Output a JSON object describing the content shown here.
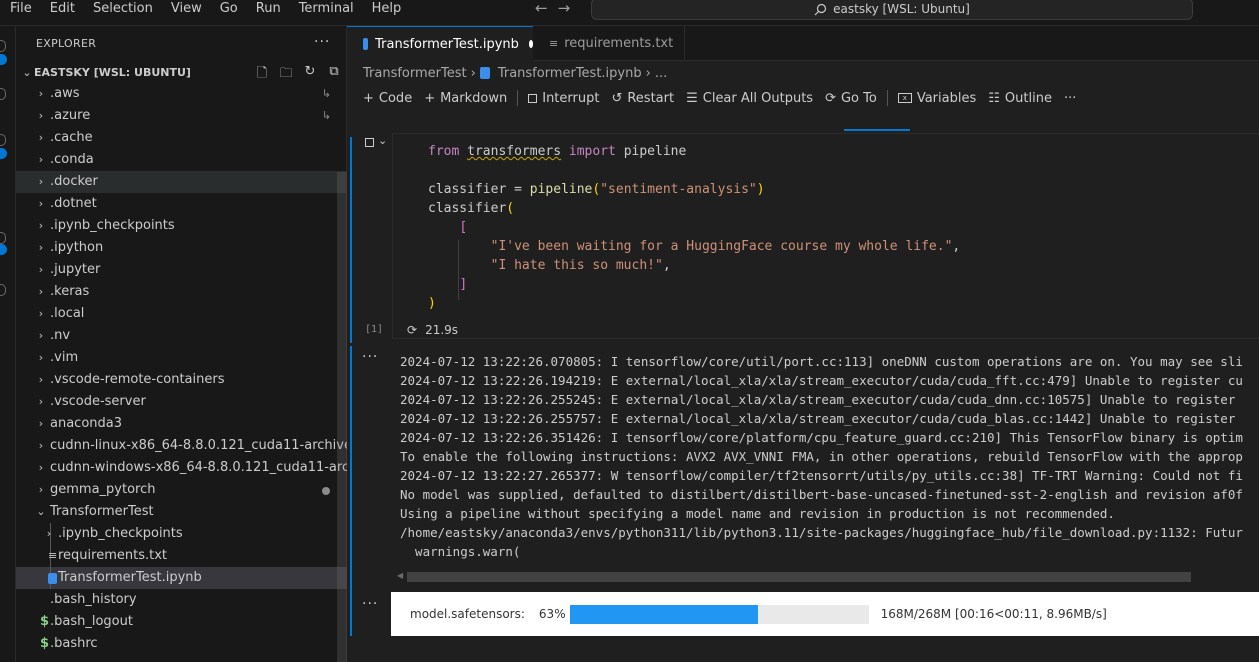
{
  "menu": [
    "File",
    "Edit",
    "Selection",
    "View",
    "Go",
    "Run",
    "Terminal",
    "Help"
  ],
  "search": {
    "text": "eastsky [WSL: Ubuntu]"
  },
  "explorer": {
    "title": "EXPLORER",
    "root": "EASTSKY [WSL: UBUNTU]",
    "items": [
      {
        "label": ".aws",
        "type": "folder",
        "depth": 0,
        "status": "↳"
      },
      {
        "label": ".azure",
        "type": "folder",
        "depth": 0,
        "status": "↳"
      },
      {
        "label": ".cache",
        "type": "folder",
        "depth": 0
      },
      {
        "label": ".conda",
        "type": "folder",
        "depth": 0
      },
      {
        "label": ".docker",
        "type": "folder",
        "depth": 0,
        "hover": true
      },
      {
        "label": ".dotnet",
        "type": "folder",
        "depth": 0
      },
      {
        "label": ".ipynb_checkpoints",
        "type": "folder",
        "depth": 0
      },
      {
        "label": ".ipython",
        "type": "folder",
        "depth": 0
      },
      {
        "label": ".jupyter",
        "type": "folder",
        "depth": 0
      },
      {
        "label": ".keras",
        "type": "folder",
        "depth": 0
      },
      {
        "label": ".local",
        "type": "folder",
        "depth": 0
      },
      {
        "label": ".nv",
        "type": "folder",
        "depth": 0
      },
      {
        "label": ".vim",
        "type": "folder",
        "depth": 0
      },
      {
        "label": ".vscode-remote-containers",
        "type": "folder",
        "depth": 0
      },
      {
        "label": ".vscode-server",
        "type": "folder",
        "depth": 0
      },
      {
        "label": "anaconda3",
        "type": "folder",
        "depth": 0
      },
      {
        "label": "cudnn-linux-x86_64-8.8.0.121_cuda11-archive",
        "type": "folder",
        "depth": 0
      },
      {
        "label": "cudnn-windows-x86_64-8.8.0.121_cuda11-archive",
        "type": "folder",
        "depth": 0
      },
      {
        "label": "gemma_pytorch",
        "type": "folder",
        "depth": 0,
        "dot": true
      },
      {
        "label": "TransformerTest",
        "type": "folder-open",
        "depth": 0
      },
      {
        "label": ".ipynb_checkpoints",
        "type": "folder",
        "depth": 1
      },
      {
        "label": "requirements.txt",
        "type": "txt",
        "depth": 1
      },
      {
        "label": "TransformerTest.ipynb",
        "type": "ipynb",
        "depth": 1,
        "selected": true
      },
      {
        "label": ".bash_history",
        "type": "file",
        "depth": 0
      },
      {
        "label": ".bash_logout",
        "type": "sh",
        "depth": 0
      },
      {
        "label": ".bashrc",
        "type": "sh",
        "depth": 0
      }
    ]
  },
  "tabs": [
    {
      "label": "TransformerTest.ipynb",
      "active": true
    },
    {
      "label": "requirements.txt",
      "active": false
    }
  ],
  "breadcrumb": {
    "folder": "TransformerTest",
    "file": "TransformerTest.ipynb",
    "more": "..."
  },
  "toolbar": {
    "code": "Code",
    "markdown": "Markdown",
    "interrupt": "Interrupt",
    "restart": "Restart",
    "clear": "Clear All Outputs",
    "goto": "Go To",
    "variables": "Variables",
    "outline": "Outline"
  },
  "cell": {
    "exec_count": "[1]",
    "duration": "21.9s",
    "code": {
      "l1_kw1": "from",
      "l1_mod": "transformers",
      "l1_kw2": "import",
      "l1_name": "pipeline",
      "l3_var": "classifier",
      "l3_eq": " = ",
      "l3_fn": "pipeline",
      "l3_arg": "\"sentiment-analysis\"",
      "l4_var": "classifier",
      "l6_str": "\"I've been waiting for a HuggingFace course my whole life.\"",
      "l7_str": "\"I hate this so much!\""
    }
  },
  "output": {
    "lines": [
      "2024-07-12 13:22:26.070805: I tensorflow/core/util/port.cc:113] oneDNN custom operations are on. You may see sli",
      "2024-07-12 13:22:26.194219: E external/local_xla/xla/stream_executor/cuda/cuda_fft.cc:479] Unable to register cu",
      "2024-07-12 13:22:26.255245: E external/local_xla/xla/stream_executor/cuda/cuda_dnn.cc:10575] Unable to register",
      "2024-07-12 13:22:26.255757: E external/local_xla/xla/stream_executor/cuda/cuda_blas.cc:1442] Unable to register",
      "2024-07-12 13:22:26.351426: I tensorflow/core/platform/cpu_feature_guard.cc:210] This TensorFlow binary is optim",
      "To enable the following instructions: AVX2 AVX_VNNI FMA, in other operations, rebuild TensorFlow with the approp",
      "2024-07-12 13:22:27.265377: W tensorflow/compiler/tf2tensorrt/utils/py_utils.cc:38] TF-TRT Warning: Could not fi",
      "No model was supplied, defaulted to distilbert/distilbert-base-uncased-finetuned-sst-2-english and revision af0f",
      "Using a pipeline without specifying a model name and revision in production is not recommended.",
      "/home/eastsky/anaconda3/envs/python311/lib/python3.11/site-packages/huggingface_hub/file_download.py:1132: Futur",
      "  warnings.warn("
    ]
  },
  "progress": {
    "label": "model.safetensors:",
    "percent_text": "63%",
    "fraction": 0.63,
    "info": "168M/268M  [00:16<00:11,  8.96MB/s]"
  },
  "colors": {
    "accent": "#0078d4",
    "progress_fill": "#2196f3"
  }
}
